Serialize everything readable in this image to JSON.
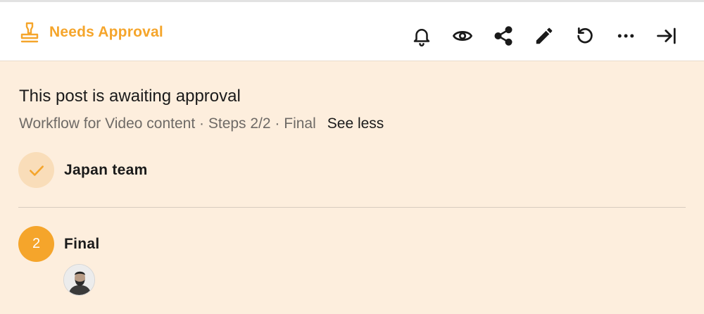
{
  "header": {
    "status_label": "Needs Approval",
    "status_icon": "stamp-icon",
    "accent_color": "#f5a52b",
    "toolbar_icons": [
      "bell-icon",
      "eye-icon",
      "share-icon",
      "pencil-icon",
      "refresh-icon",
      "more-icon",
      "collapse-panel-icon"
    ]
  },
  "banner": {
    "title": "This post is awaiting approval",
    "meta": "Workflow for Video content · Steps 2/2 · Final",
    "see_less": "See less",
    "background": "#fdeedd"
  },
  "steps": [
    {
      "status": "completed",
      "name": "Japan team"
    },
    {
      "status": "current",
      "number": "2",
      "name": "Final"
    }
  ]
}
